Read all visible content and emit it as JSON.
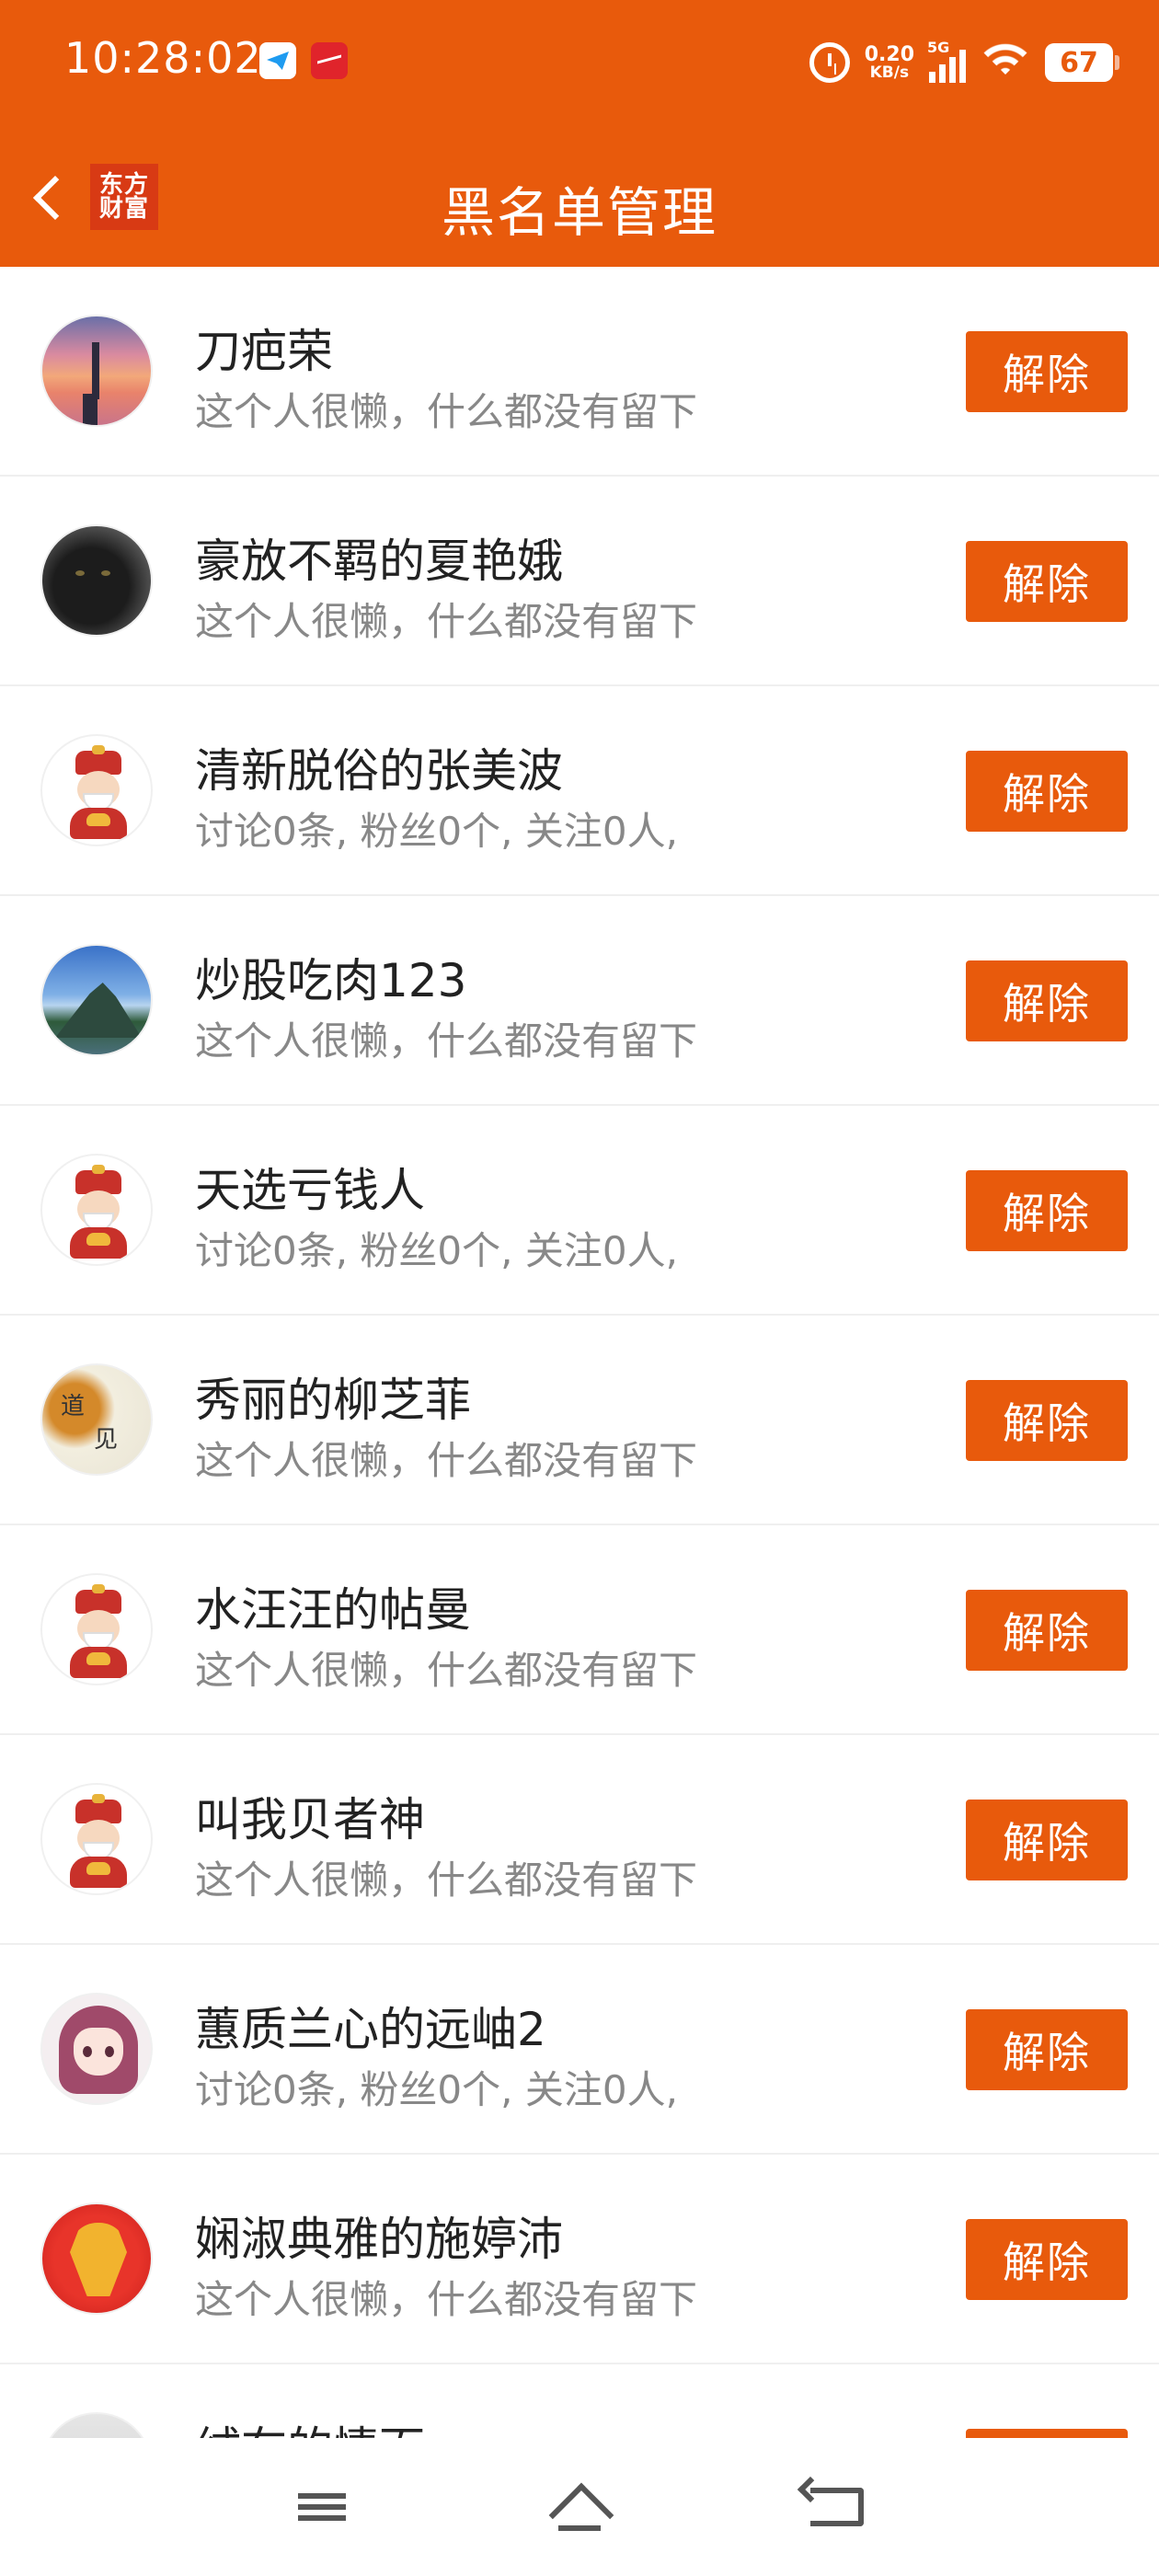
{
  "status_bar": {
    "time": "10:28:02",
    "network_speed_value": "0.20",
    "network_speed_unit": "KB/s",
    "network_type": "5G",
    "battery": "67"
  },
  "header": {
    "logo_line1": "东方",
    "logo_line2": "财富",
    "title": "黑名单管理"
  },
  "list": {
    "remove_label": "解除",
    "items": [
      {
        "name": "刀疤荣",
        "desc": "这个人很懒，什么都没有留下",
        "avatar": "sunset-lighthouse"
      },
      {
        "name": "豪放不羁的夏艳娥",
        "desc": "这个人很懒，什么都没有留下",
        "avatar": "black-cat"
      },
      {
        "name": "清新脱俗的张美波",
        "desc": "讨论0条, 粉丝0个, 关注0人,",
        "avatar": "fortune-god"
      },
      {
        "name": "炒股吃肉123",
        "desc": "这个人很懒，什么都没有留下",
        "avatar": "mountain"
      },
      {
        "name": "天选亏钱人",
        "desc": "讨论0条, 粉丝0个, 关注0人,",
        "avatar": "fortune-god"
      },
      {
        "name": "秀丽的柳芝菲",
        "desc": "这个人很懒，什么都没有留下",
        "avatar": "calligraphy"
      },
      {
        "name": "水汪汪的帖曼",
        "desc": "这个人很懒，什么都没有留下",
        "avatar": "fortune-god"
      },
      {
        "name": "叫我贝者神",
        "desc": "这个人很懒，什么都没有留下",
        "avatar": "fortune-god"
      },
      {
        "name": "蕙质兰心的远岫2",
        "desc": "讨论0条, 粉丝0个, 关注0人,",
        "avatar": "anime-girl"
      },
      {
        "name": "娴淑典雅的施婷沛",
        "desc": "这个人很懒，什么都没有留下",
        "avatar": "red-dragon"
      },
      {
        "name": "绒布的情面",
        "desc": "",
        "avatar": "partial"
      }
    ]
  },
  "colors": {
    "brand": "#e85a0c",
    "text_primary": "#222222",
    "text_secondary": "#888888"
  }
}
